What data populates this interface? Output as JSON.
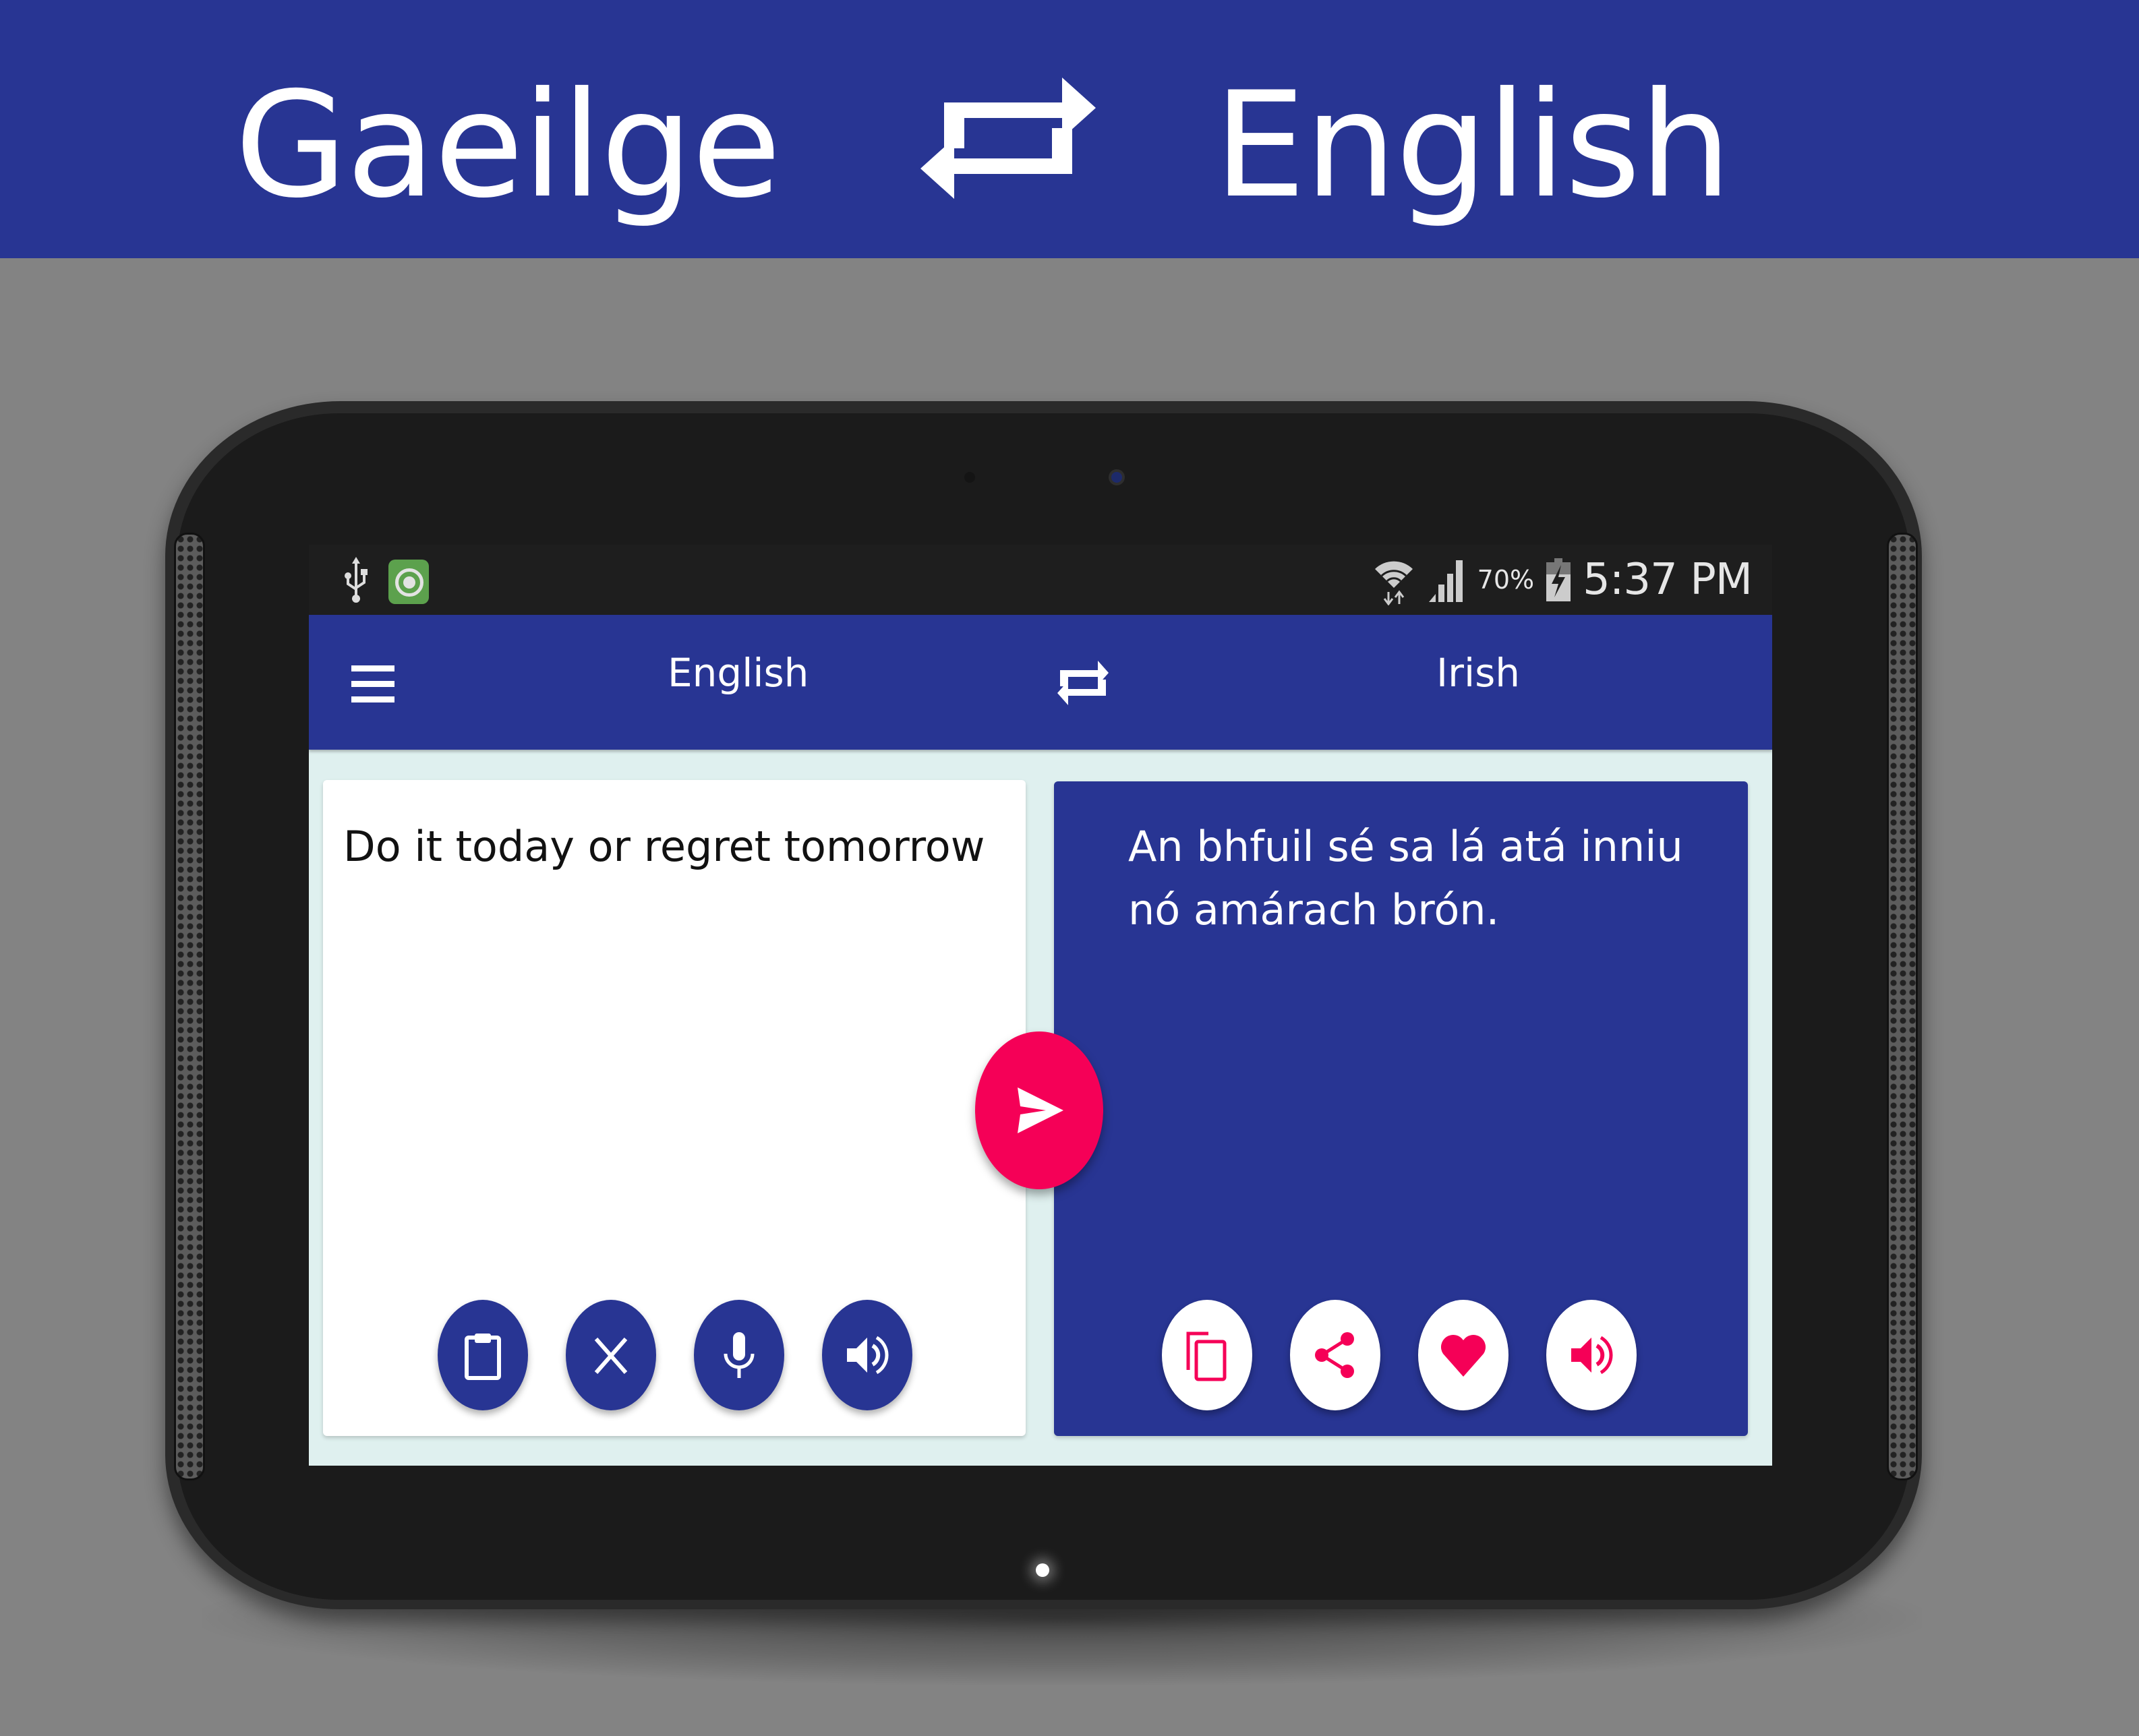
{
  "banner": {
    "source_language": "Gaeilge",
    "target_language": "English",
    "swap_icon": "swap-arrows-icon"
  },
  "status_bar": {
    "left_icons": [
      "usb-icon",
      "app-notification-icon"
    ],
    "right_icons": [
      "wifi-icon",
      "signal-icon",
      "battery-charging-icon"
    ],
    "battery_percent": "70%",
    "time": "5:37 PM"
  },
  "toolbar": {
    "menu_icon": "hamburger-menu-icon",
    "source_language": "English",
    "swap_icon": "swap-arrows-icon",
    "target_language": "Irish"
  },
  "source_panel": {
    "text": "Do it today or regret tomorrow",
    "buttons": [
      {
        "name": "paste",
        "icon": "clipboard-icon"
      },
      {
        "name": "clear",
        "icon": "close-icon"
      },
      {
        "name": "voice-input",
        "icon": "microphone-icon"
      },
      {
        "name": "speak",
        "icon": "speaker-icon"
      }
    ]
  },
  "translate_button": {
    "icon": "send-icon"
  },
  "target_panel": {
    "text": "An bhfuil sé sa lá atá inniu nó amárach brón.",
    "buttons": [
      {
        "name": "copy",
        "icon": "copy-icon"
      },
      {
        "name": "share",
        "icon": "share-icon"
      },
      {
        "name": "favorite",
        "icon": "heart-icon"
      },
      {
        "name": "speak",
        "icon": "speaker-icon"
      }
    ]
  },
  "colors": {
    "primary": "#283593",
    "accent": "#f50057",
    "background": "#dff0ef",
    "status_bar": "#1e1e1e",
    "page_background": "#838383"
  }
}
